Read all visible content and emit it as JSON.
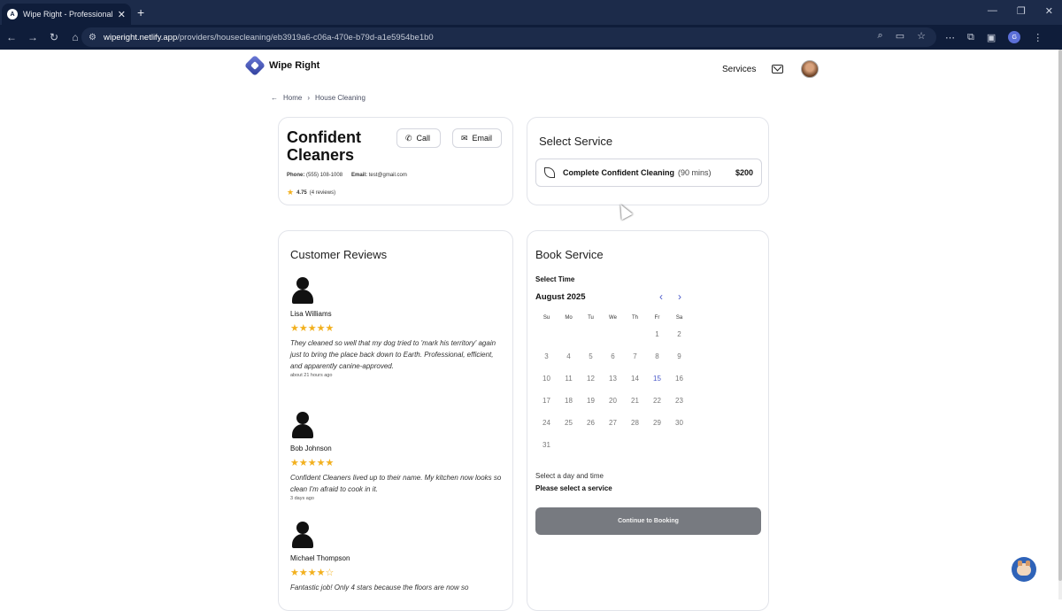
{
  "browser": {
    "tab_title": "Wipe Right - Professional Clea",
    "tab_favicon": "A",
    "url_host": "wiperight.netlify.app",
    "url_path": "/providers/housecleaning/eb3919a6-c06a-470e-b79d-a1e5954be1b0",
    "profile_initial": "G"
  },
  "header": {
    "brand": "Wipe Right",
    "services_link": "Services"
  },
  "breadcrumb": {
    "home": "Home",
    "current": "House Cleaning"
  },
  "provider": {
    "name": "Confident Cleaners",
    "call_label": "Call",
    "email_label": "Email",
    "phone_label": "Phone:",
    "phone": "(555) 108-1008",
    "email_label_inline": "Email:",
    "email": "test@gmail.com",
    "rating": "4.75",
    "reviews_count": "(4 reviews)"
  },
  "select_service": {
    "title": "Select Service",
    "service_name": "Complete Confident Cleaning",
    "duration": "(90 mins)",
    "price": "$200"
  },
  "reviews": {
    "title": "Customer Reviews",
    "items": [
      {
        "name": "Lisa Williams",
        "stars": "★★★★★",
        "text": "They cleaned so well that my dog tried to 'mark his territory' again just to bring the place back down to Earth. Professional, efficient, and apparently canine-approved.",
        "time": "about 21 hours ago",
        "rating": 5
      },
      {
        "name": "Bob Johnson",
        "stars": "★★★★★",
        "text": "Confident Cleaners lived up to their name. My kitchen now looks so clean I'm afraid to cook in it.",
        "time": "3 days ago",
        "rating": 5
      },
      {
        "name": "Michael Thompson",
        "stars": "★★★★",
        "stars_off": "☆",
        "text": "Fantastic job! Only 4 stars because the floors are now so",
        "rating": 4
      }
    ]
  },
  "booking": {
    "title": "Book Service",
    "select_time": "Select Time",
    "month": "August 2025",
    "weekdays": [
      "Su",
      "Mo",
      "Tu",
      "We",
      "Th",
      "Fr",
      "Sa"
    ],
    "weeks": [
      [
        "",
        "",
        "",
        "",
        "",
        "1",
        "2"
      ],
      [
        "3",
        "4",
        "5",
        "6",
        "7",
        "8",
        "9"
      ],
      [
        "10",
        "11",
        "12",
        "13",
        "14",
        "15",
        "16"
      ],
      [
        "17",
        "18",
        "19",
        "20",
        "21",
        "22",
        "23"
      ],
      [
        "24",
        "25",
        "26",
        "27",
        "28",
        "29",
        "30"
      ],
      [
        "31",
        "",
        "",
        "",
        "",
        "",
        ""
      ]
    ],
    "today": "15",
    "hint_day_time": "Select a day and time",
    "hint_service": "Please select a service",
    "continue_label": "Continue to Booking"
  },
  "colors": {
    "accent": "#4a59c9",
    "star": "#f2b01e",
    "disabled_button": "#777a80"
  }
}
